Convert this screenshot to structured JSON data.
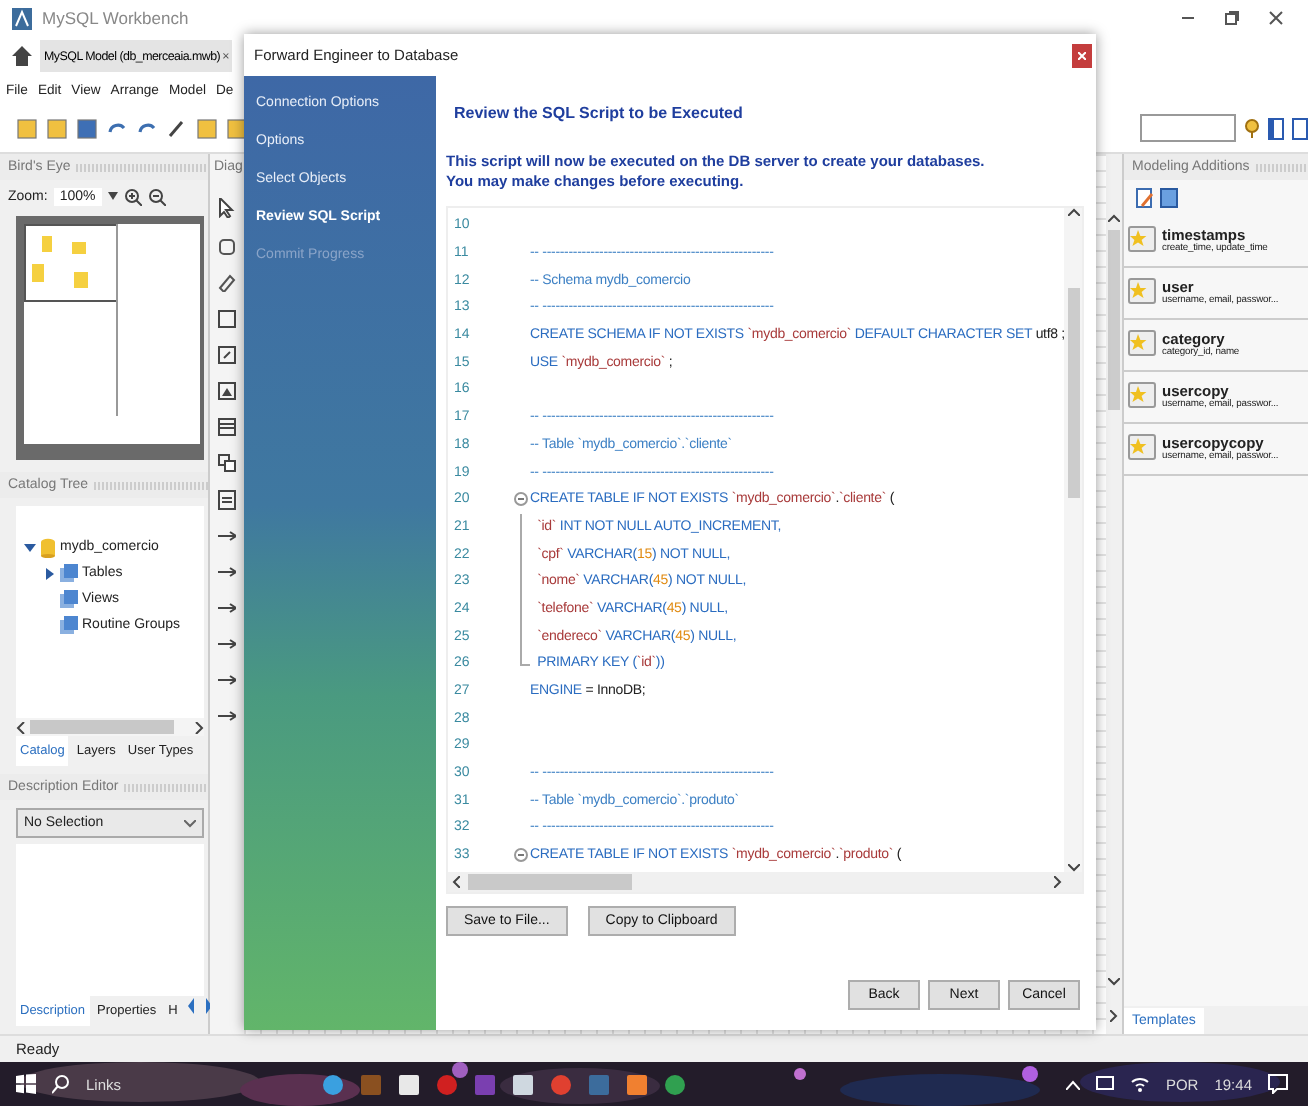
{
  "app": {
    "title": "MySQL Workbench"
  },
  "document_tab": {
    "label": "MySQL Model (db_merceaia.mwb)",
    "close": "×"
  },
  "menu": [
    "File",
    "Edit",
    "View",
    "Arrange",
    "Model",
    "De"
  ],
  "birds_eye": {
    "title": "Bird's Eye",
    "zoom_label": "Zoom:",
    "zoom_value": "100%"
  },
  "diagram_header": "Diag",
  "catalog": {
    "title": "Catalog Tree",
    "tree": [
      {
        "label": "mydb_comercio",
        "expanded": true,
        "children": [
          {
            "label": "Tables",
            "expanded": false
          },
          {
            "label": "Views"
          },
          {
            "label": "Routine Groups"
          }
        ]
      }
    ],
    "tabs": [
      {
        "label": "Catalog",
        "selected": true
      },
      {
        "label": "Layers",
        "selected": false
      },
      {
        "label": "User Types",
        "selected": false
      }
    ]
  },
  "description_editor": {
    "title": "Description Editor",
    "select": "No Selection",
    "tabs": [
      {
        "label": "Description",
        "selected": true
      },
      {
        "label": "Properties",
        "selected": false
      },
      {
        "label": "H",
        "selected": false
      }
    ]
  },
  "modeling_additions": {
    "title": "Modeling Additions",
    "tab": "Templates",
    "items": [
      {
        "name": "timestamps",
        "detail": "create_time, update_time"
      },
      {
        "name": "user",
        "detail": "username, email, passwor..."
      },
      {
        "name": "category",
        "detail": "category_id, name"
      },
      {
        "name": "usercopy",
        "detail": "username, email, passwor..."
      },
      {
        "name": "usercopycopy",
        "detail": "username, email, passwor..."
      }
    ]
  },
  "dialog": {
    "title": "Forward Engineer to Database",
    "steps": [
      {
        "label": "Connection Options",
        "selected": false,
        "disabled": false
      },
      {
        "label": "Options",
        "selected": false,
        "disabled": false
      },
      {
        "label": "Select Objects",
        "selected": false,
        "disabled": false
      },
      {
        "label": "Review SQL Script",
        "selected": true,
        "disabled": false
      },
      {
        "label": "Commit Progress",
        "selected": false,
        "disabled": true
      }
    ],
    "heading": "Review the SQL Script to be Executed",
    "description": [
      "This script will now be executed on the DB server to create your databases.",
      "You may make changes before executing."
    ],
    "script": [
      {
        "number": "10"
      },
      {
        "number": "11",
        "tokens": [
          {
            "kind": "comment",
            "text": "-- -----------------------------------------------------"
          }
        ]
      },
      {
        "number": "12",
        "tokens": [
          {
            "kind": "comment",
            "text": "-- Schema mydb_comercio"
          }
        ]
      },
      {
        "number": "13",
        "tokens": [
          {
            "kind": "comment",
            "text": "-- -----------------------------------------------------"
          }
        ]
      },
      {
        "number": "14",
        "tokens": [
          {
            "kind": "keyword",
            "text": "CREATE SCHEMA IF NOT EXISTS "
          },
          {
            "kind": "string",
            "text": "`mydb_comercio`"
          },
          {
            "kind": "keyword",
            "text": " DEFAULT CHARACTER SET "
          },
          {
            "kind": "plain",
            "text": "utf8 ;"
          }
        ]
      },
      {
        "number": "15",
        "tokens": [
          {
            "kind": "keyword",
            "text": "USE "
          },
          {
            "kind": "string",
            "text": "`mydb_comercio`"
          },
          {
            "kind": "plain",
            "text": " ;"
          }
        ]
      },
      {
        "number": "16"
      },
      {
        "number": "17",
        "tokens": [
          {
            "kind": "comment",
            "text": "-- -----------------------------------------------------"
          }
        ]
      },
      {
        "number": "18",
        "tokens": [
          {
            "kind": "comment",
            "text": "-- Table `mydb_comercio`.`cliente`"
          }
        ]
      },
      {
        "number": "19",
        "tokens": [
          {
            "kind": "comment",
            "text": "-- -----------------------------------------------------"
          }
        ]
      },
      {
        "number": "20",
        "fold_open": true,
        "tokens": [
          {
            "kind": "keyword",
            "text": "CREATE TABLE IF NOT EXISTS "
          },
          {
            "kind": "string",
            "text": "`mydb_comercio`"
          },
          {
            "kind": "plain",
            "text": "."
          },
          {
            "kind": "string",
            "text": "`cliente`"
          },
          {
            "kind": "plain",
            "text": " ("
          }
        ]
      },
      {
        "number": "21",
        "in_fold": true,
        "tokens": [
          {
            "kind": "string",
            "text": "  `id`"
          },
          {
            "kind": "keyword",
            "text": " INT NOT NULL AUTO_INCREMENT,"
          }
        ]
      },
      {
        "number": "22",
        "in_fold": true,
        "tokens": [
          {
            "kind": "string",
            "text": "  `cpf`"
          },
          {
            "kind": "keyword",
            "text": " VARCHAR("
          },
          {
            "kind": "number",
            "text": "15"
          },
          {
            "kind": "keyword",
            "text": ") NOT NULL,"
          }
        ]
      },
      {
        "number": "23",
        "in_fold": true,
        "tokens": [
          {
            "kind": "string",
            "text": "  `nome`"
          },
          {
            "kind": "keyword",
            "text": " VARCHAR("
          },
          {
            "kind": "number",
            "text": "45"
          },
          {
            "kind": "keyword",
            "text": ") NOT NULL,"
          }
        ]
      },
      {
        "number": "24",
        "in_fold": true,
        "tokens": [
          {
            "kind": "string",
            "text": "  `telefone`"
          },
          {
            "kind": "keyword",
            "text": " VARCHAR("
          },
          {
            "kind": "number",
            "text": "45"
          },
          {
            "kind": "keyword",
            "text": ") NULL,"
          }
        ]
      },
      {
        "number": "25",
        "in_fold": true,
        "tokens": [
          {
            "kind": "string",
            "text": "  `endereco`"
          },
          {
            "kind": "keyword",
            "text": " VARCHAR("
          },
          {
            "kind": "number",
            "text": "45"
          },
          {
            "kind": "keyword",
            "text": ") NULL,"
          }
        ]
      },
      {
        "number": "26",
        "fold_end": true,
        "tokens": [
          {
            "kind": "keyword",
            "text": "  PRIMARY KEY ("
          },
          {
            "kind": "string",
            "text": "`id`"
          },
          {
            "kind": "keyword",
            "text": "))"
          }
        ]
      },
      {
        "number": "27",
        "tokens": [
          {
            "kind": "keyword",
            "text": "ENGINE"
          },
          {
            "kind": "plain",
            "text": " = InnoDB;"
          }
        ]
      },
      {
        "number": "28"
      },
      {
        "number": "29"
      },
      {
        "number": "30",
        "tokens": [
          {
            "kind": "comment",
            "text": "-- -----------------------------------------------------"
          }
        ]
      },
      {
        "number": "31",
        "tokens": [
          {
            "kind": "comment",
            "text": "-- Table `mydb_comercio`.`produto`"
          }
        ]
      },
      {
        "number": "32",
        "tokens": [
          {
            "kind": "comment",
            "text": "-- -----------------------------------------------------"
          }
        ]
      },
      {
        "number": "33",
        "fold_open": true,
        "tokens": [
          {
            "kind": "keyword",
            "text": "CREATE TABLE IF NOT EXISTS "
          },
          {
            "kind": "string",
            "text": "`mydb_comercio`"
          },
          {
            "kind": "plain",
            "text": "."
          },
          {
            "kind": "string",
            "text": "`produto`"
          },
          {
            "kind": "plain",
            "text": " ("
          }
        ]
      }
    ],
    "buttons": [
      "Save to File...",
      "Copy to Clipboard"
    ],
    "nav_buttons": [
      "Back",
      "Next",
      "Cancel"
    ]
  },
  "status_bar": "Ready",
  "taskbar": {
    "search": "Links",
    "language": "POR",
    "time": "19:44"
  }
}
